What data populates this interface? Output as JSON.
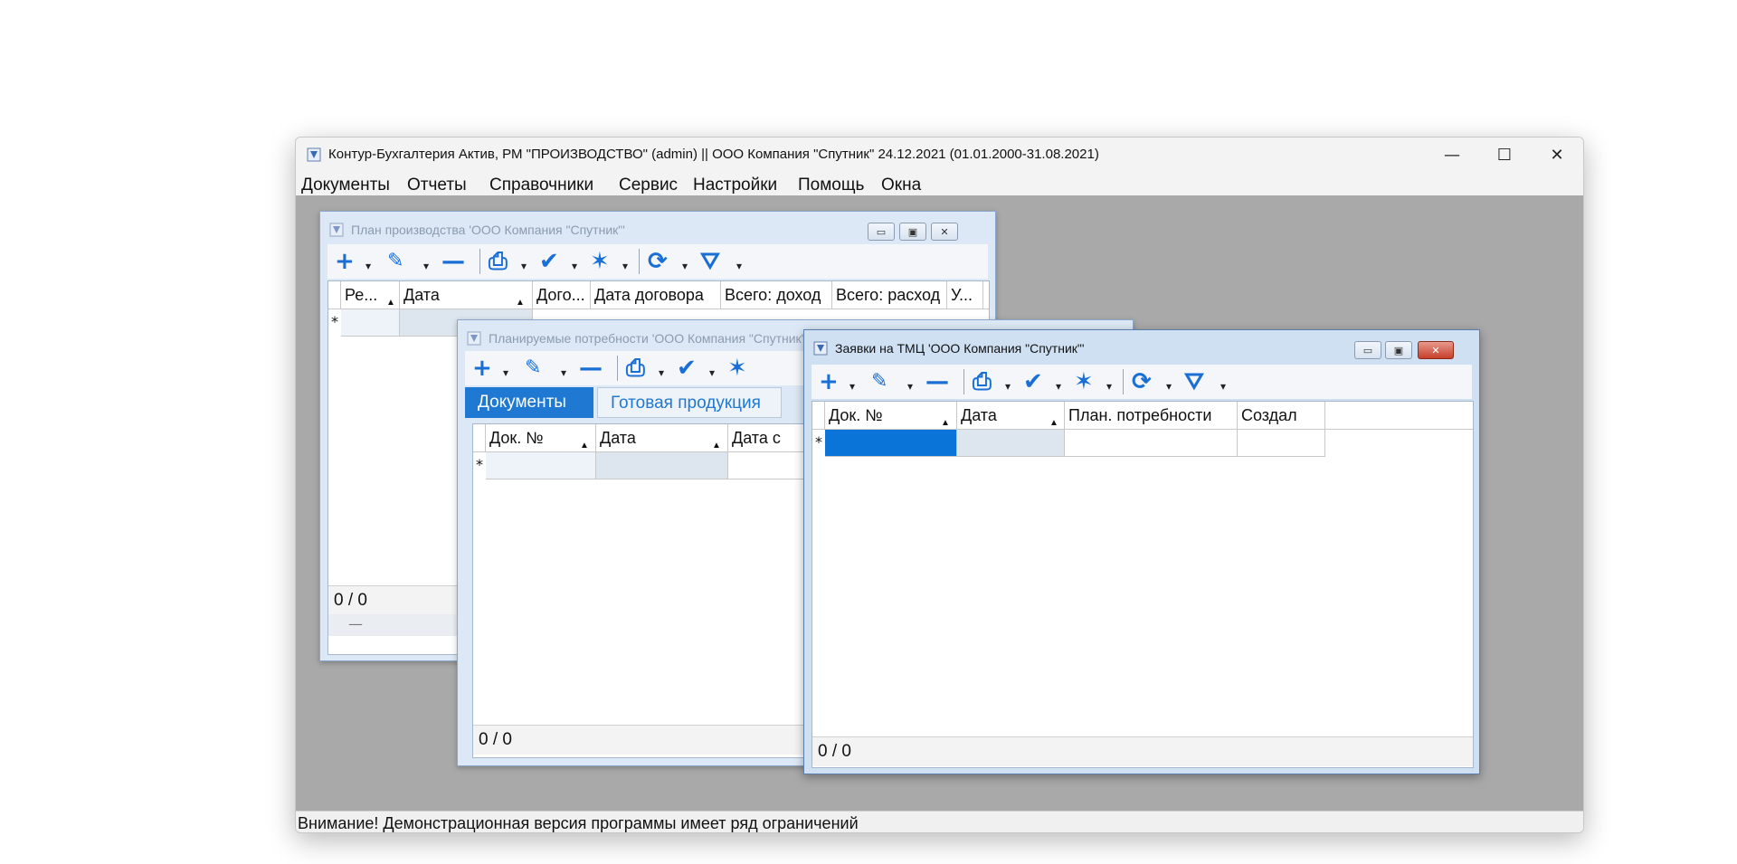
{
  "app": {
    "title": "Контур-Бухгалтерия Актив, РМ \"ПРОИЗВОДСТВО\" (admin) || ООО Компания \"Спутник\" 24.12.2021 (01.01.2000-31.08.2021)",
    "controls": {
      "minimize": "—",
      "maximize": "☐",
      "close": "✕"
    }
  },
  "menu": [
    "Документы",
    "Отчеты",
    "Справочники",
    "Сервис",
    "Настройки",
    "Помощь",
    "Окна"
  ],
  "status": "Внимание! Демонстрационная версия программы имеет ряд ограничений",
  "windows": {
    "plan": {
      "title": "План производства  'ООО Компания \"Спутник\"'",
      "columns": [
        "Ре...",
        "Дата",
        "Дого...",
        "Дата договора",
        "Всего: доход",
        "Всего: расход",
        "У..."
      ],
      "footer": "0 / 0",
      "extra": "—"
    },
    "needs": {
      "title": "Планируемые потребности  'ООО Компания \"Спутник\"'",
      "tabs": [
        "Документы",
        "Готовая продукция"
      ],
      "columns": [
        "Док. №",
        "Дата",
        "Дата с"
      ],
      "footer": "0 / 0"
    },
    "requests": {
      "title": "Заявки на ТМЦ  'ООО Компания \"Спутник\"'",
      "columns": [
        "Док. №",
        "Дата",
        "План. потребности",
        "Создал"
      ],
      "footer": "0 / 0"
    }
  },
  "toolbar_glyphs": {
    "add": "+",
    "edit": "✎",
    "remove": "—",
    "print": "⎙",
    "approve": "✔",
    "magic": "✶",
    "refresh": "⟳",
    "filter": "⛛",
    "dropdown": "▾"
  },
  "grid": {
    "new_row_marker": "*",
    "sort_marker": "▲"
  },
  "colors": {
    "accent": "#1f78d1",
    "mdi_background": "#a9a9a9",
    "selection": "#0a74d8"
  }
}
